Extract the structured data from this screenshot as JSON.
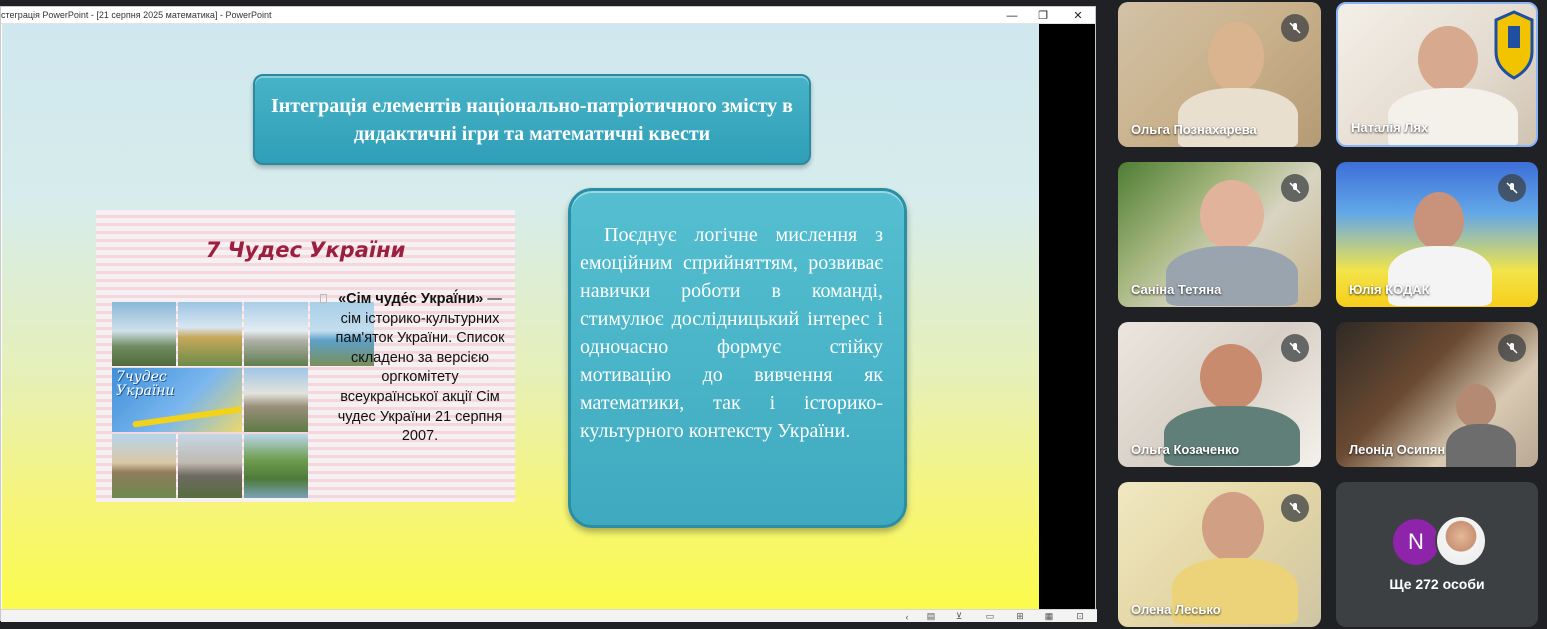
{
  "ppt": {
    "window_title": "стеграція PowerPoint - [21 серпня 2025 математика] - PowerPoint",
    "controls": {
      "minimize": "—",
      "restore": "❐",
      "close": "✕"
    }
  },
  "slide": {
    "title": "Інтеграція елементів національно-патріотичного змісту в дидактичні ігри та математичні квести",
    "image_card": {
      "heading": "7 Чудес України",
      "logo_line1": "7чудес",
      "logo_line2": "України",
      "text_bold": "«Сім чуде́с Украї́ни»",
      "text_rest": "— сім історико-культурних пам'яток України. Список складено за версією оргкомітету всеукраїнської акції Сім чудес України 21 серпня 2007."
    },
    "description": "Поєднує логічне мислення з емоційним сприйняттям, розвиває навички роботи в команді, стимулює дослідницький інтерес і одночасно формує стійку мотивацію до вивчення як математики, так і історико-культурного контексту України."
  },
  "participants": [
    {
      "name": "Ольга Познахарева",
      "muted": true
    },
    {
      "name": "Наталія Лях",
      "muted": false,
      "speaking": true
    },
    {
      "name": "Саніна Тетяна",
      "muted": true
    },
    {
      "name": "Юлія КОДАК",
      "muted": true
    },
    {
      "name": "Ольга Козаченко",
      "muted": true
    },
    {
      "name": "Леонід Осипян",
      "muted": true
    },
    {
      "name": "Олена Лесько",
      "muted": true
    }
  ],
  "more": {
    "initial": "N",
    "label": "Ще 272 особи"
  },
  "colors": {
    "accent_teal": "#3faabf",
    "meet_bg": "#202124",
    "speaking_border": "#8ab4f8"
  }
}
